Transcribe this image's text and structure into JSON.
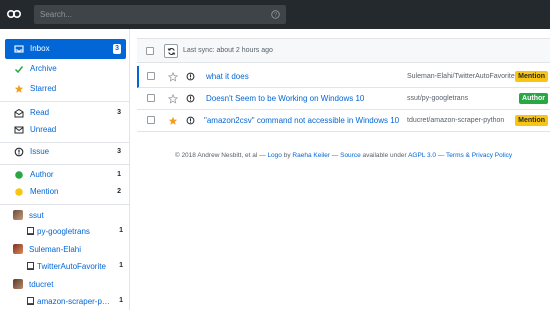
{
  "colors": {
    "topbar": "#24292e",
    "accent": "#0366d6",
    "mention": "#f9c513",
    "author": "#28a745",
    "star": "#f0a020"
  },
  "search": {
    "placeholder": "Search..."
  },
  "sidebar": {
    "filters": [
      {
        "label": "Inbox",
        "count": "3",
        "icon": "inbox-icon",
        "active": true
      },
      {
        "label": "Archive",
        "count": "",
        "icon": "check-icon"
      },
      {
        "label": "Starred",
        "count": "",
        "icon": "star-icon"
      },
      {
        "label": "Read",
        "count": "3",
        "icon": "mail-read-icon"
      },
      {
        "label": "Unread",
        "count": "",
        "icon": "mail-icon"
      },
      {
        "label": "Issue",
        "count": "3",
        "icon": "issue-icon"
      },
      {
        "label": "Author",
        "count": "1",
        "icon": "green-dot-icon"
      },
      {
        "label": "Mention",
        "count": "2",
        "icon": "yellow-dot-icon"
      }
    ],
    "owners": [
      {
        "name": "ssut",
        "repo": "py-googletrans",
        "count": "1"
      },
      {
        "name": "Suleman-Elahi",
        "repo": "TwitterAutoFavorite",
        "count": "1"
      },
      {
        "name": "tducret",
        "repo": "amazon-scraper-pyth..",
        "count": "1"
      }
    ]
  },
  "toolbar": {
    "last_sync": "Last sync: about 2 hours ago"
  },
  "notifications": [
    {
      "title": "what it does",
      "repo": "Suleman-Elahi/TwitterAutoFavorite",
      "reason": "Mention",
      "starred": false
    },
    {
      "title": "Doesn't Seem to be Working on Windows 10",
      "repo": "ssut/py-googletrans",
      "reason": "Author",
      "starred": false
    },
    {
      "title": "\"amazon2csv\" command not accessible in Windows 10",
      "repo": "tducret/amazon-scraper-python",
      "reason": "Mention",
      "starred": true
    }
  ],
  "footer": {
    "copyright": "© 2018 Andrew Nesbitt, et al —",
    "logo_link": "Logo",
    "logo_by": "by",
    "logo_author": "Raeha Keiler",
    "dash1": "—",
    "source_link": "Source",
    "license_text": "available under",
    "license_link": "AGPL 3.0",
    "dash2": "—",
    "terms_link": "Terms & Privacy Policy"
  }
}
